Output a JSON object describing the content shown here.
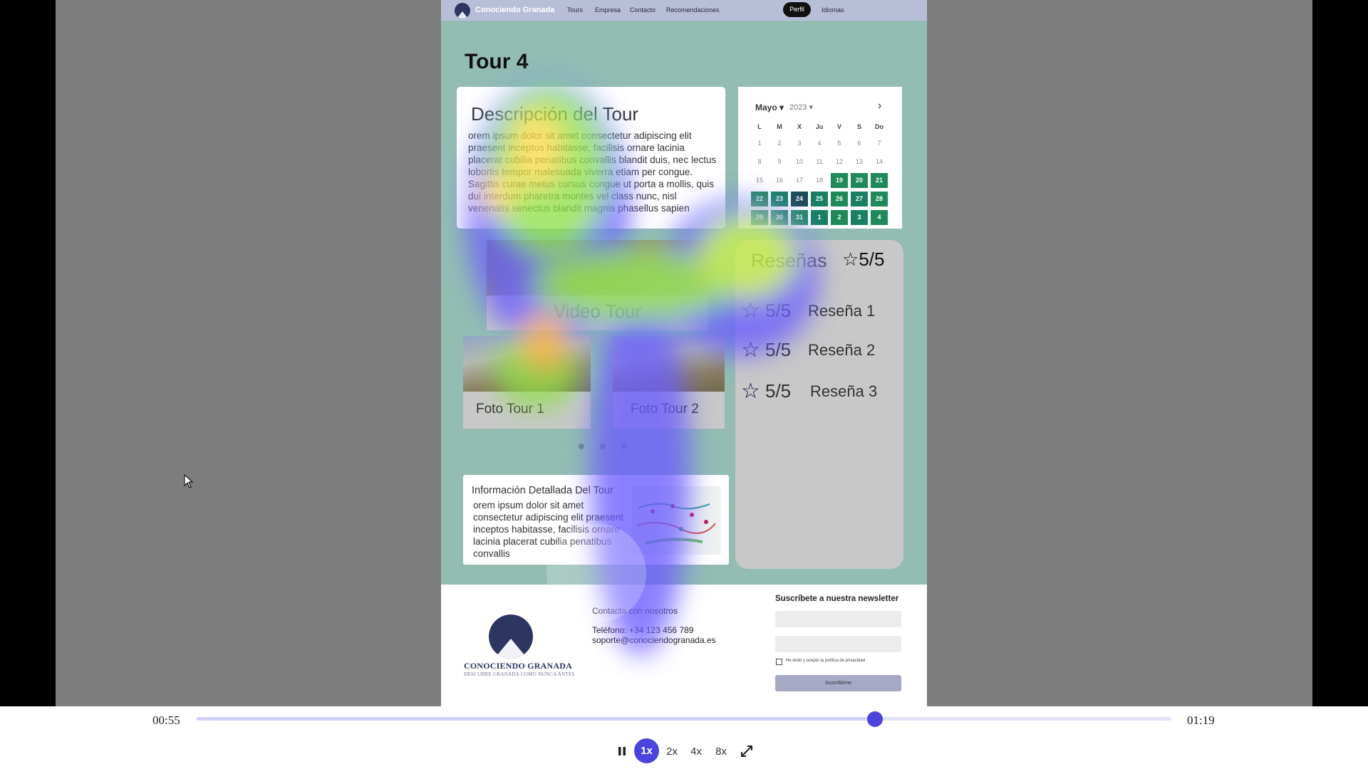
{
  "nav": {
    "brand": "Conociendo Granada",
    "links": [
      "Tours",
      "Empresa",
      "Contacto",
      "Recomendaciones"
    ],
    "active": "Perfil",
    "languages": "Idiomas"
  },
  "tour": {
    "title": "Tour 4",
    "description_heading": "Descripción del Tour",
    "description_text": "orem ipsum dolor sit amet consectetur adipiscing elit praesent inceptos habitasse, facilisis ornare lacinia placerat cubilia penatibus convallis blandit duis, nec lectus lobortis tempor malesuada viverra etiam per congue. Sagittis curae metus cursus congue ut porta a mollis, quis dui interdum pharetra montes vel class nunc, nisl venenatis senectus blandit magnis phasellus sapien"
  },
  "calendar": {
    "month": "Mayo",
    "year": "2023",
    "weekdays": [
      "L",
      "M",
      "X",
      "Ju",
      "V",
      "S",
      "Do"
    ],
    "weeks": [
      [
        "1",
        "2",
        "3",
        "4",
        "5",
        "6",
        "7"
      ],
      [
        "8",
        "9",
        "10",
        "11",
        "12",
        "13",
        "14"
      ],
      [
        "15",
        "16",
        "17",
        "18",
        "19",
        "20",
        "21"
      ],
      [
        "22",
        "23",
        "24",
        "25",
        "26",
        "27",
        "28"
      ],
      [
        "29",
        "30",
        "31",
        "1",
        "2",
        "3",
        "4"
      ]
    ]
  },
  "media": {
    "video_label": "Video Tour",
    "photo1_label": "Foto Tour 1",
    "photo2_label": "Foto Tour 2"
  },
  "reviews": {
    "heading": "Reseñas",
    "overall": "5/5",
    "items": [
      {
        "score": "5/5",
        "name": "Reseña 1"
      },
      {
        "score": "5/5",
        "name": "Reseña 2"
      },
      {
        "score": "5/5",
        "name": "Reseña 3"
      }
    ]
  },
  "info": {
    "heading": "Información Detallada Del Tour",
    "text": "orem ipsum dolor sit amet consectetur adipiscing elit praesent inceptos habitasse, facilisis ornare lacinia placerat cubilia penatibus convallis"
  },
  "footer": {
    "brand": "CONOCIENDO GRANADA",
    "tagline": "DESCUBRE GRANADA COMO NUNCA ANTES",
    "contact_heading": "Contacta con nosotros",
    "phone": "Teléfono: +34 123 456 789",
    "email": "soporte@conociendogranada.es",
    "newsletter_heading": "Suscríbete a nuestra newsletter",
    "privacy_label": "He leído y acepto la política de privacidad",
    "subscribe_label": "Suscribirme"
  },
  "player": {
    "current_time": "00:55",
    "total_time": "01:19",
    "progress": 0.696,
    "speeds": [
      "1x",
      "2x",
      "4x",
      "8x"
    ],
    "active_speed": "1x"
  },
  "colors": {
    "accent": "#4b43e0",
    "calendar_available": "#1e8a5a",
    "calendar_selected": "#1c4c59",
    "site_background": "#93bdb3"
  }
}
